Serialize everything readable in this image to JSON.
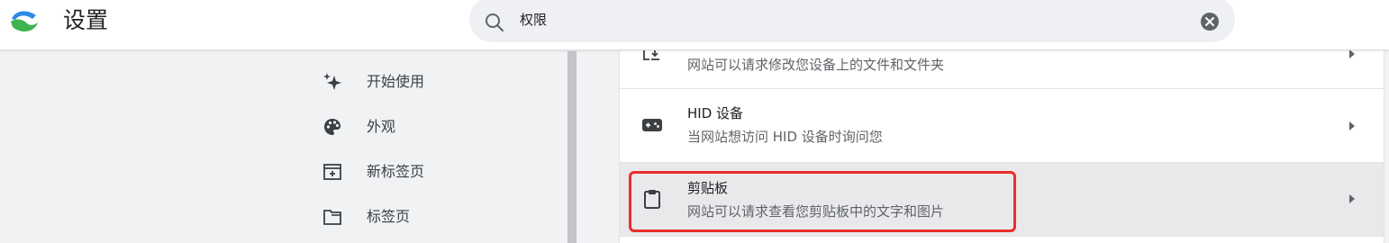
{
  "header": {
    "title": "设置",
    "logo_icon": "app-logo-icon"
  },
  "search": {
    "value": "权限",
    "icon": "search-icon",
    "clear_icon": "clear-icon"
  },
  "sidebar": {
    "items": [
      {
        "label": "开始使用",
        "icon": "sparkle-icon"
      },
      {
        "label": "外观",
        "icon": "palette-icon"
      },
      {
        "label": "新标签页",
        "icon": "new-tab-icon"
      },
      {
        "label": "标签页",
        "icon": "folder-tab-icon"
      }
    ]
  },
  "permissions": {
    "rows": [
      {
        "title": "",
        "desc": "网站可以请求修改您设备上的文件和文件夹",
        "icon": "file-edit-icon"
      },
      {
        "title": "HID 设备",
        "desc": "当网站想访问 HID 设备时询问您",
        "icon": "gamepad-icon"
      },
      {
        "title": "剪贴板",
        "desc": "网站可以请求查看您剪贴板中的文字和图片",
        "icon": "clipboard-icon"
      }
    ]
  },
  "colors": {
    "highlight_outline": "#ec2d2a",
    "highlight_row": "#e9e9eb",
    "accent": "#1a73e8"
  }
}
